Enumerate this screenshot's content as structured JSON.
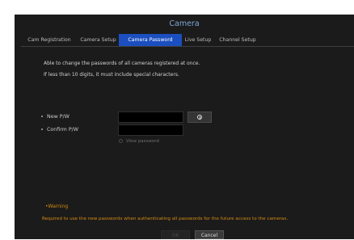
{
  "window": {
    "title": "Camera"
  },
  "tabs": [
    {
      "label": "Cam Registration",
      "active": false
    },
    {
      "label": "Camera Setup",
      "active": false
    },
    {
      "label": "Camera Password",
      "active": true
    },
    {
      "label": "Live Setup",
      "active": false
    },
    {
      "label": "Channel Setup",
      "active": false
    }
  ],
  "description": {
    "line1": "Able to change the passwords of all cameras registered at once.",
    "line2": "If less than 10 digits, it must include special characters."
  },
  "form": {
    "new_pw_label": "New P/W",
    "new_pw_value": "",
    "confirm_pw_label": "Confirm P/W",
    "confirm_pw_value": "",
    "view_password_label": "View password",
    "view_password_checked": false
  },
  "warning": {
    "title": "•Warning",
    "text": "Required to use the new passwords when authenticating all passwords for the future access to the cameras."
  },
  "buttons": {
    "ok_label": "OK",
    "ok_enabled": false,
    "cancel_label": "Cancel"
  },
  "colors": {
    "background": "#1b1b1b",
    "accent": "#1b4fbf",
    "title": "#7fa8d8",
    "warning": "#d58a12"
  },
  "icons": {
    "info_button": "info-circle-icon"
  }
}
